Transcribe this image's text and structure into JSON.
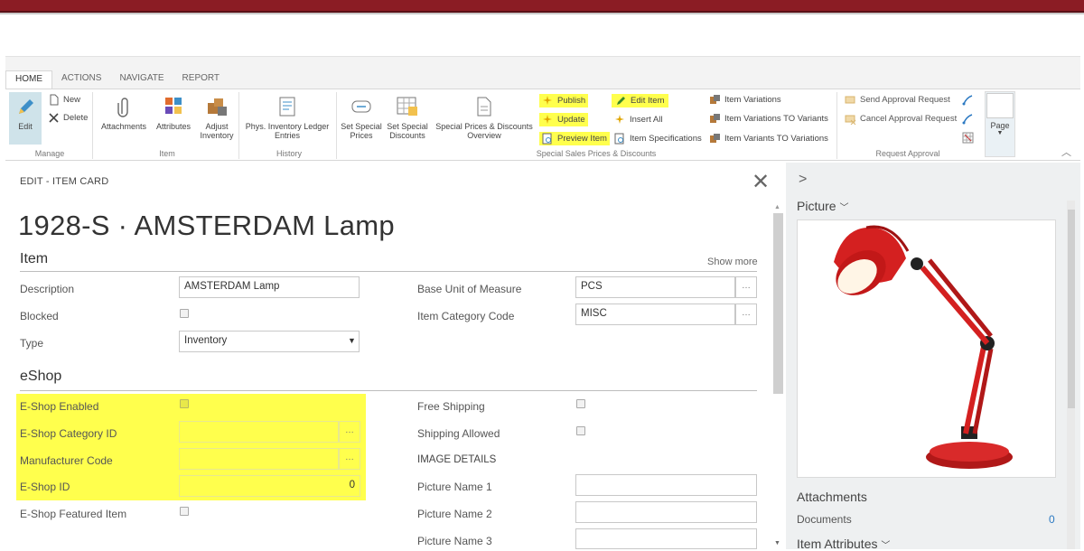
{
  "ribbon": {
    "tabs": [
      "HOME",
      "ACTIONS",
      "NAVIGATE",
      "REPORT"
    ],
    "manage": {
      "edit": "Edit",
      "new": "New",
      "delete": "Delete",
      "group": "Manage"
    },
    "item": {
      "attachments": "Attachments",
      "attributes": "Attributes",
      "adjust1": "Adjust",
      "adjust2": "Inventory",
      "group": "Item"
    },
    "history": {
      "label1": "Phys. Inventory Ledger",
      "label2": "Entries",
      "group": "History"
    },
    "special": {
      "set_prices1": "Set Special",
      "set_prices2": "Prices",
      "set_discounts1": "Set Special",
      "set_discounts2": "Discounts",
      "overview1": "Special Prices & Discounts",
      "overview2": "Overview",
      "publish": "Publish",
      "update": "Update",
      "preview_item": "Preview Item",
      "edit_item": "Edit Item",
      "insert_all": "Insert All",
      "item_specifications": "Item Specifications",
      "item_variations": "Item Variations",
      "item_variations_to_variants": "Item Variations TO Variants",
      "item_variants_to_variations": "Item Variants TO Variations",
      "group": "Special Sales Prices & Discounts"
    },
    "approval": {
      "send": "Send Approval Request",
      "cancel": "Cancel Approval Request",
      "group": "Request Approval"
    },
    "page": {
      "label": "Page"
    }
  },
  "page": {
    "mode_title": "EDIT - ITEM CARD",
    "record_title": "1928-S · AMSTERDAM Lamp"
  },
  "item_section": {
    "title": "Item",
    "show_more": "Show more",
    "description_label": "Description",
    "description_value": "AMSTERDAM Lamp",
    "blocked_label": "Blocked",
    "type_label": "Type",
    "type_value": "Inventory",
    "base_uom_label": "Base Unit of Measure",
    "base_uom_value": "PCS",
    "category_label": "Item Category Code",
    "category_value": "MISC"
  },
  "eshop_section": {
    "title": "eShop",
    "enabled_label": "E-Shop Enabled",
    "category_id_label": "E-Shop Category ID",
    "manufacturer_label": "Manufacturer Code",
    "eshop_id_label": "E-Shop ID",
    "eshop_id_value": "0",
    "featured_label": "E-Shop Featured Item",
    "free_shipping_label": "Free Shipping",
    "shipping_allowed_label": "Shipping Allowed",
    "image_details_label": "IMAGE DETAILS",
    "picture1_label": "Picture Name 1",
    "picture2_label": "Picture Name 2",
    "picture3_label": "Picture Name 3"
  },
  "factbox": {
    "expand_glyph": ">",
    "picture_title": "Picture",
    "attachments_title": "Attachments",
    "documents_label": "Documents",
    "documents_count": "0",
    "attributes_title": "Item Attributes"
  },
  "colors": {
    "highlight": "#ffff4d",
    "brand_bar": "#8b1c24",
    "link": "#2b79c2"
  }
}
